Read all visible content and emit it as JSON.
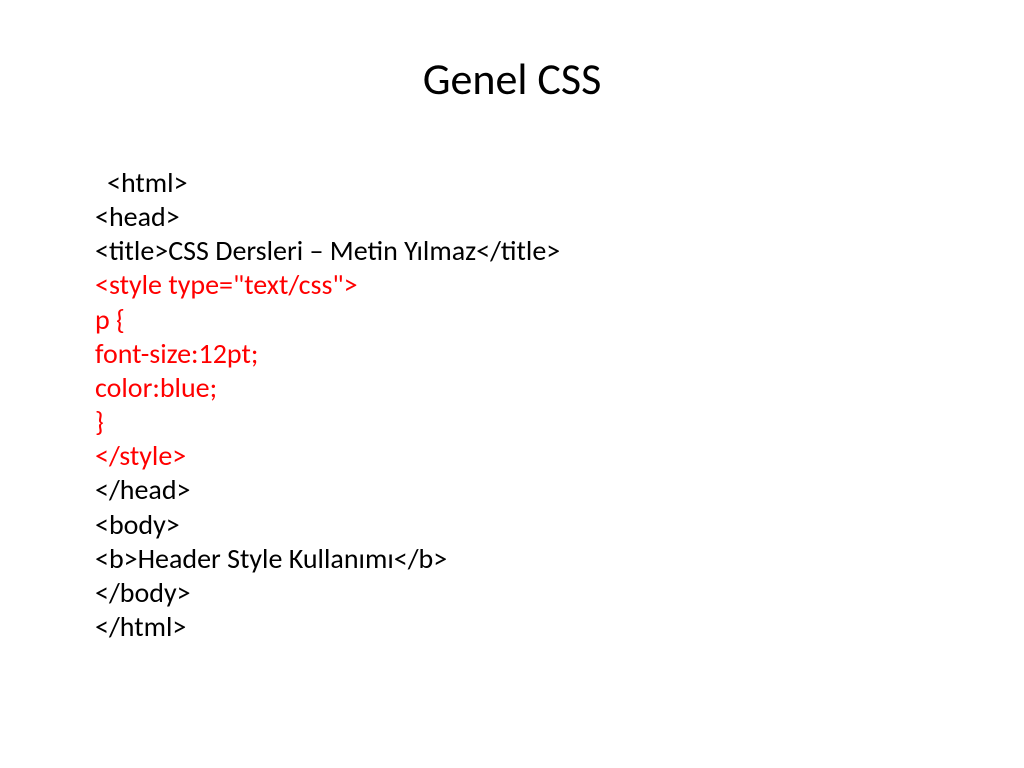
{
  "title": "Genel CSS",
  "code": {
    "line1": "<html>",
    "line2": "<head>",
    "line3": "<title>CSS Dersleri – Metin Yılmaz</title>",
    "line4": "<style type=\"text/css\">",
    "line5": "p {",
    "line6": "font-size:12pt;",
    "line7": "color:blue;",
    "line8": "}",
    "line9": "</style>",
    "line10": "</head>",
    "line11": "<body>",
    "line12": "<b>Header Style Kullanımı</b>",
    "line13": "</body>",
    "line14": "</html>"
  }
}
